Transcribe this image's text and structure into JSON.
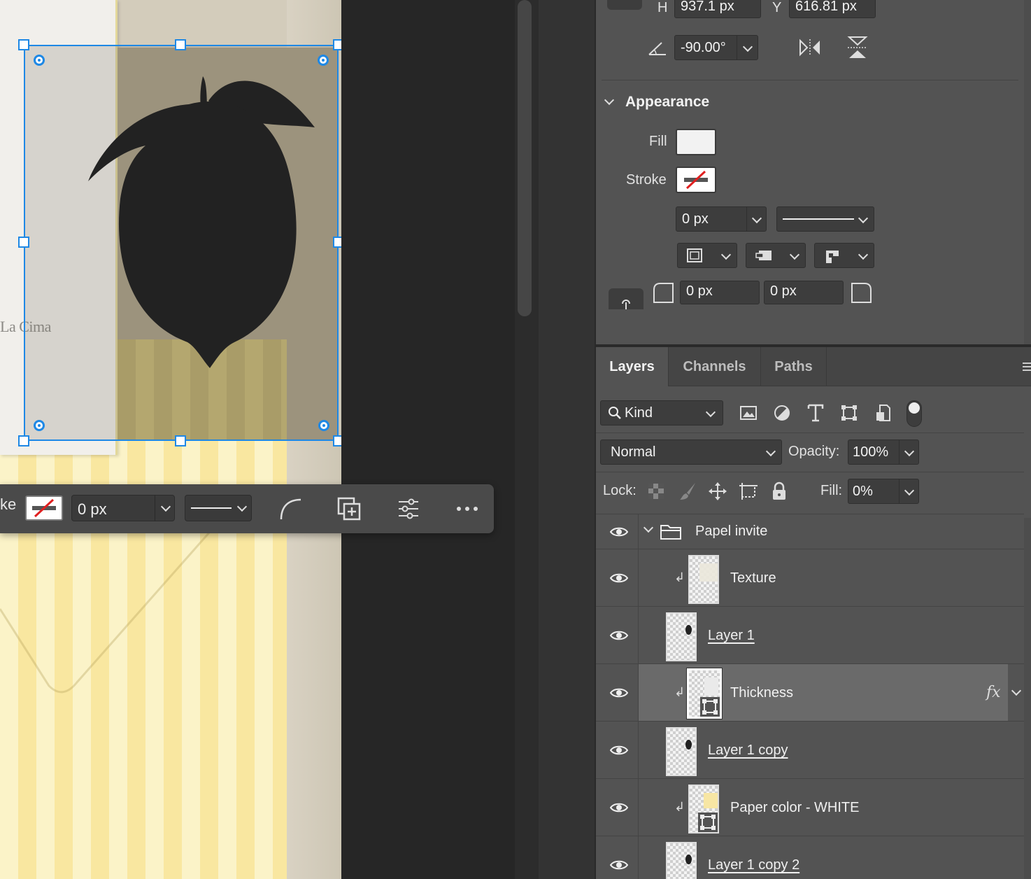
{
  "canvas": {
    "card_text": "La Cima"
  },
  "taskbar": {
    "label": "ke",
    "stroke_size": "0 px"
  },
  "properties": {
    "h_label": "H",
    "h_value": "937.1 px",
    "y_label": "Y",
    "y_value": "616.81 px",
    "angle_value": "-90.00°",
    "appearance_title": "Appearance",
    "fill_label": "Fill",
    "stroke_label": "Stroke",
    "stroke_width": "0 px",
    "corner_radius_1": "0 px",
    "corner_radius_2": "0 px"
  },
  "layers_panel": {
    "tabs": [
      "Layers",
      "Channels",
      "Paths"
    ],
    "filter_kind": "Kind",
    "blend_mode": "Normal",
    "opacity_label": "Opacity:",
    "opacity_value": "100%",
    "lock_label": "Lock:",
    "fill_label": "Fill:",
    "fill_value": "0%",
    "layers": [
      {
        "name": "Papel invite"
      },
      {
        "name": "Texture"
      },
      {
        "name": "Layer 1"
      },
      {
        "name": "Thickness",
        "fx": "fx"
      },
      {
        "name": "Layer 1 copy"
      },
      {
        "name": "Paper color - WHITE"
      },
      {
        "name": "Layer 1 copy 2"
      }
    ]
  },
  "colors": {
    "selection_blue": "#1e88e5",
    "panel_bg": "#535353",
    "selected_layer_bg": "#6a6a6a"
  }
}
